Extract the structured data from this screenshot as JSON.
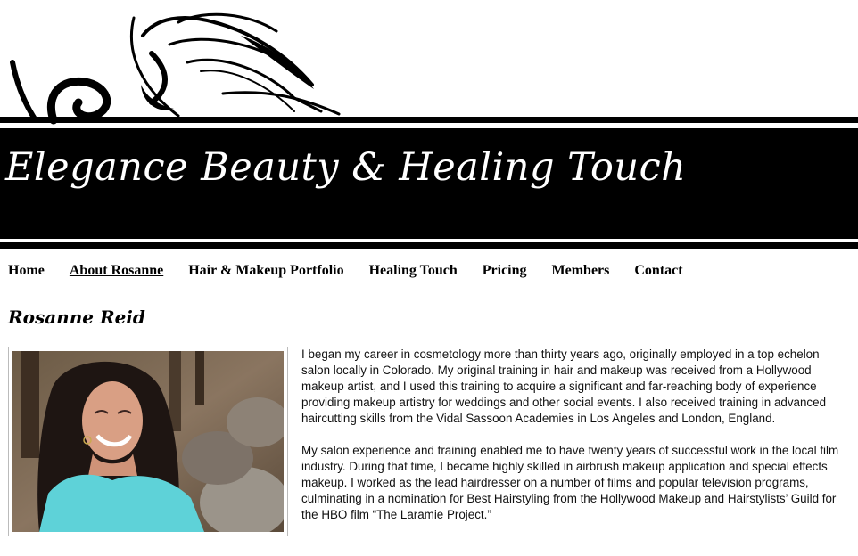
{
  "site": {
    "title": "Elegance Beauty & Healing Touch"
  },
  "nav": {
    "items": [
      {
        "label": "Home"
      },
      {
        "label": "About Rosanne",
        "active": true
      },
      {
        "label": "Hair & Makeup Portfolio"
      },
      {
        "label": "Healing Touch"
      },
      {
        "label": "Pricing"
      },
      {
        "label": "Members"
      },
      {
        "label": "Contact"
      }
    ]
  },
  "page": {
    "heading": "Rosanne Reid",
    "paragraphs": [
      "I began my career in cosmetology more than thirty years ago, originally employed in a top echelon salon locally in Colorado. My original training in hair and makeup was received from a Hollywood makeup artist, and I used this training to acquire a significant and far-reaching body of experience providing makeup artistry for weddings and other social events. I also received training in advanced haircutting skills from the Vidal Sassoon Academies in Los Angeles and London, England.",
      " My salon experience and training enabled me to have twenty years of successful work in the local film industry. During that time, I became highly skilled in airbrush makeup application and special effects makeup. I worked as the lead hairdresser on a number of films and popular television programs, culminating in a nomination for Best Hairstyling from the Hollywood Makeup and Hairstylists’ Guild for the HBO film “The Laramie Project.”"
    ]
  },
  "colors": {
    "banner": "#000000",
    "title_text": "#ffffff",
    "top_accent": "#5fd3d8"
  }
}
